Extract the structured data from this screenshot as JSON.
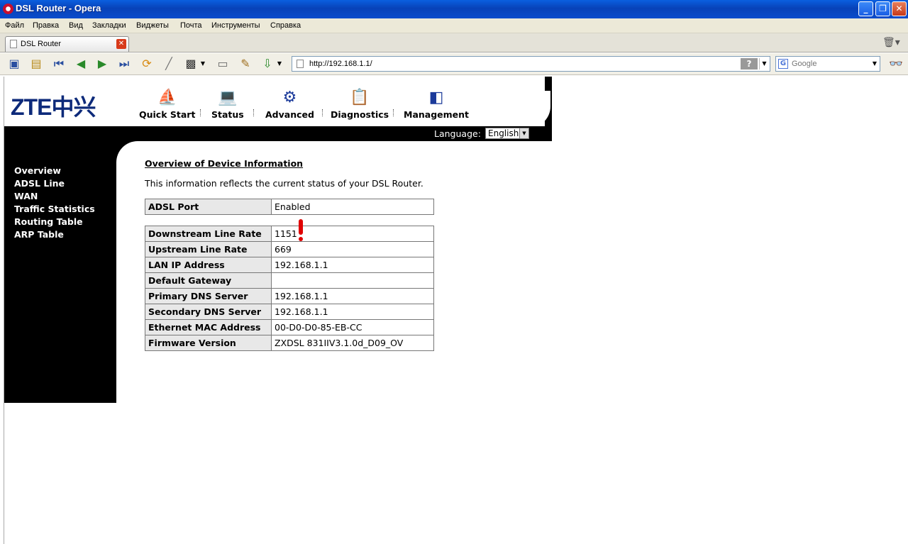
{
  "window": {
    "title": "DSL Router - Opera"
  },
  "menu": [
    "Файл",
    "Правка",
    "Вид",
    "Закладки",
    "Виджеты",
    "Почта",
    "Инструменты",
    "Справка"
  ],
  "tab": {
    "label": "DSL Router"
  },
  "address": {
    "url": "http://192.168.1.1/",
    "help_label": "?"
  },
  "search": {
    "placeholder": "Google",
    "engine_letter": "G"
  },
  "router": {
    "logo": "ZTE中兴",
    "nav": [
      "Quick Start",
      "Status",
      "Advanced",
      "Diagnostics",
      "Management"
    ],
    "language_label": "Language:",
    "language_value": "English",
    "sidebar": [
      "Overview",
      "ADSL Line",
      "WAN",
      "Traffic Statistics",
      "Routing Table",
      "ARP Table"
    ],
    "heading": "Overview of Device Information",
    "description": "This information reflects the current status of your DSL Router.",
    "port_table": [
      {
        "key": "ADSL Port",
        "value": "Enabled"
      }
    ],
    "info_table": [
      {
        "key": "Downstream Line Rate",
        "value": "1151"
      },
      {
        "key": "Upstream Line Rate",
        "value": "669"
      },
      {
        "key": "LAN IP Address",
        "value": "192.168.1.1"
      },
      {
        "key": "Default Gateway",
        "value": ""
      },
      {
        "key": "Primary DNS Server",
        "value": "192.168.1.1"
      },
      {
        "key": "Secondary DNS Server",
        "value": "192.168.1.1"
      },
      {
        "key": "Ethernet MAC Address",
        "value": "00-D0-D0-85-EB-CC"
      },
      {
        "key": "Firmware Version",
        "value": "ZXDSL 831IIV3.1.0d_D09_OV"
      }
    ]
  },
  "colors": {
    "xp_blue": "#0a4ccc",
    "zte_blue": "#0d2a7a",
    "annotation_red": "#e00000"
  }
}
